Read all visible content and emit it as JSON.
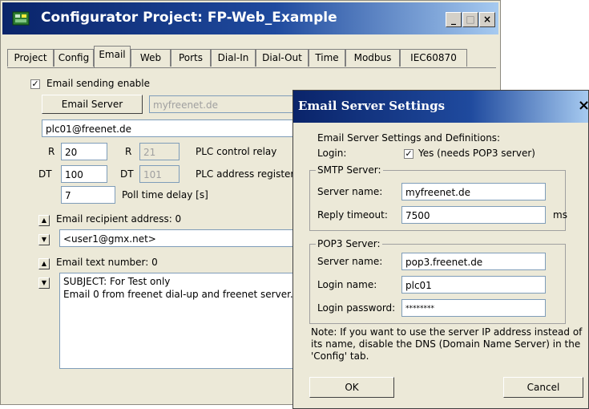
{
  "window": {
    "title": "Configurator Project: FP-Web_Example",
    "minimize": "_",
    "maximize": "□",
    "close": "×"
  },
  "tabs": [
    "Project",
    "Config",
    "Email",
    "Web",
    "Ports",
    "Dial-In",
    "Dial-Out",
    "Time",
    "Modbus",
    "IEC60870"
  ],
  "email_tab": {
    "enable_label": "Email sending enable",
    "enable_checked": true,
    "server_button": "Email Server",
    "server_value": "myfreenet.de",
    "sender": "plc01@freenet.de",
    "r_label": "R",
    "r1_value": "20",
    "r2_value": "21",
    "relay_label": "PLC control relay",
    "dt_label": "DT",
    "dt1_value": "100",
    "dt2_value": "101",
    "address_label": "PLC address register",
    "poll_value": "7",
    "poll_label": "Poll time delay [s]",
    "recipient_label": "Email recipient address: 0",
    "recipient_value": "<user1@gmx.net>",
    "text_label": "Email text number: 0",
    "text_line1": "SUBJECT: For Test only",
    "text_line2": "Email 0 from freenet dial-up and freenet server."
  },
  "dialog": {
    "title": "Email Server Settings",
    "close": "×",
    "intro": "Email Server Settings and Definitions:",
    "login_label": "Login:",
    "login_checkbox_label": "Yes (needs POP3 server)",
    "login_checked": true,
    "smtp": {
      "title": "SMTP Server:",
      "name_label": "Server name:",
      "name_value": "myfreenet.de",
      "timeout_label": "Reply timeout:",
      "timeout_value": "7500",
      "timeout_unit": "ms"
    },
    "pop3": {
      "title": "POP3 Server:",
      "name_label": "Server name:",
      "name_value": "pop3.freenet.de",
      "login_label": "Login name:",
      "login_value": "plc01",
      "password_label": "Login password:",
      "password_value": "********"
    },
    "note": "Note: If you want to use the server IP address instead of its name, disable the DNS (Domain Name Server) in the 'Config' tab.",
    "ok": "OK",
    "cancel": "Cancel"
  },
  "colors": {
    "titlebar_start": "#0a246a",
    "titlebar_end": "#a6caf0",
    "face": "#ece9d8"
  }
}
